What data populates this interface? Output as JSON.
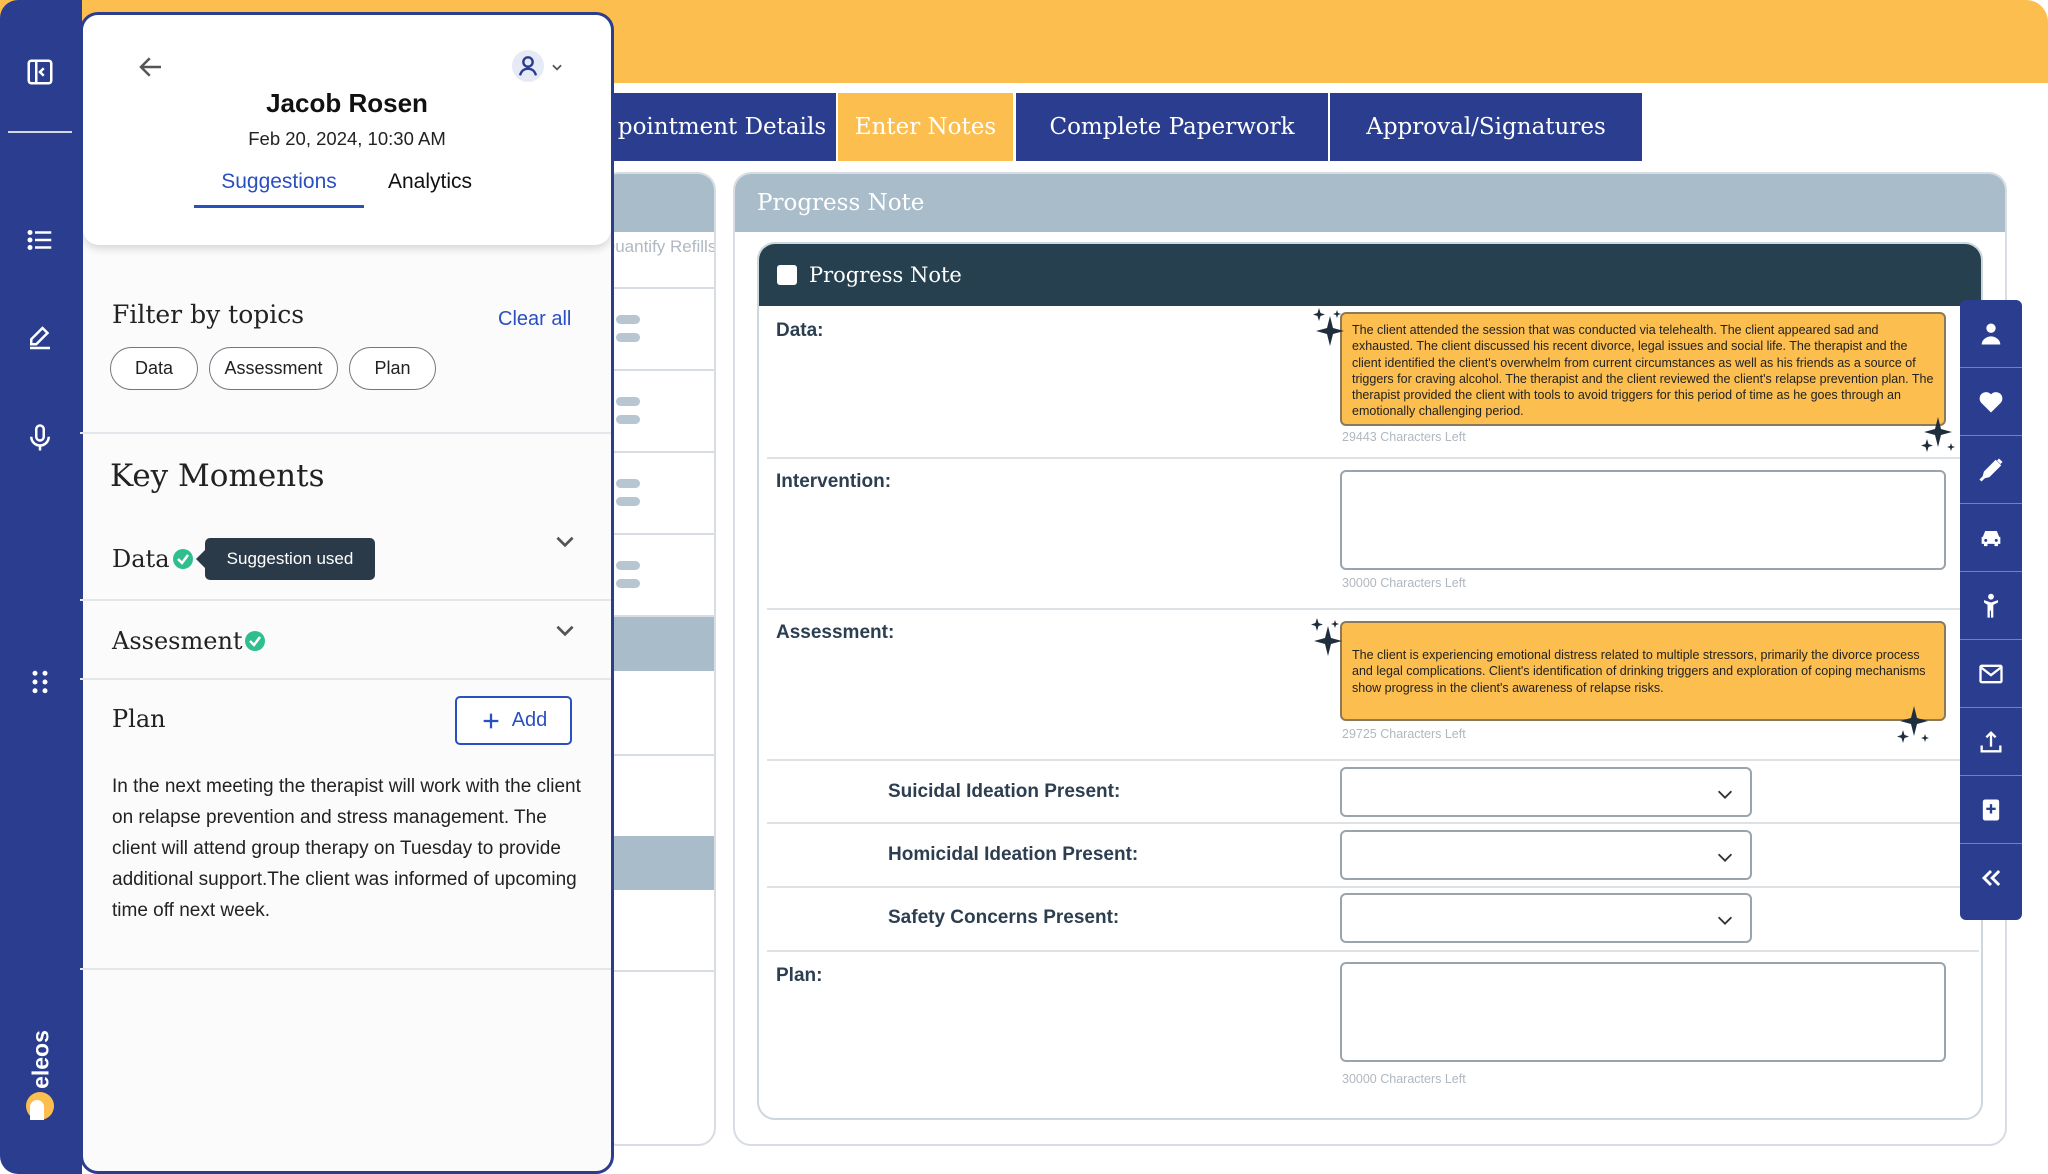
{
  "app": {
    "brand": "eleos"
  },
  "colors": {
    "brand_blue": "#2a3d8f",
    "accent_orange": "#fbbe4f",
    "note_header": "#26404f",
    "success_green": "#2fbf8f"
  },
  "tabs": [
    {
      "label": "Appointment Details",
      "visible_label": "pointment Details",
      "active": false
    },
    {
      "label": "Enter Notes",
      "active": true
    },
    {
      "label": "Complete Paperwork",
      "active": false
    },
    {
      "label": "Approval/Signatures",
      "active": false
    }
  ],
  "leftnav": {
    "icons": [
      "collapse-sidebar-icon",
      "list-icon",
      "pencil-icon",
      "microphone-icon",
      "apps-grid-icon"
    ]
  },
  "panel": {
    "client_name": "Jacob Rosen",
    "session_datetime": "Feb 20, 2024, 10:30 AM",
    "tabs": [
      {
        "label": "Suggestions",
        "active": true
      },
      {
        "label": "Analytics",
        "active": false
      }
    ],
    "filter": {
      "title": "Filter by topics",
      "clear_label": "Clear all",
      "topics": [
        "Data",
        "Assessment",
        "Plan"
      ]
    },
    "key_moments": {
      "title": "Key Moments",
      "items": [
        {
          "label": "Data",
          "used": true,
          "tooltip": "Suggestion used"
        },
        {
          "label": "Assesment",
          "used": true
        }
      ]
    },
    "plan": {
      "label": "Plan",
      "add_label": "Add",
      "text": "In the next meeting the therapist will work with the client on relapse prevention and stress management. The client will attend group therapy on Tuesday to provide additional support.The client was informed of upcoming time off next week."
    }
  },
  "midcol": {
    "header_text": "Quantify Refills"
  },
  "progress_note": {
    "outer_title": "Progress Note",
    "inner_title": "Progress Note",
    "fields": {
      "data": {
        "label": "Data:",
        "value": "The client attended the session that was conducted via telehealth. The client appeared sad and exhausted. The client discussed his recent divorce, legal issues and social life. The therapist and the client identified the client's overwhelm from current circumstances as well as his friends as a source of triggers for craving alcohol. The therapist and the client reviewed the client's relapse prevention plan. The therapist provided the client with tools to avoid triggers for this period of time as he goes through an emotionally challenging period.",
        "chars_left": "29443 Characters Left"
      },
      "intervention": {
        "label": "Intervention:",
        "value": "",
        "chars_left": "30000 Characters Left"
      },
      "assessment": {
        "label": "Assessment:",
        "value": "The client is experiencing emotional distress related to multiple stressors, primarily the divorce process and legal complications. Client's identification of drinking triggers and exploration of coping mechanisms show progress in the client's awareness of relapse risks.",
        "chars_left": "29725 Characters Left"
      },
      "suicidal": {
        "label": "Suicidal Ideation Present:",
        "value": ""
      },
      "homicidal": {
        "label": "Homicidal Ideation Present:",
        "value": ""
      },
      "safety": {
        "label": "Safety Concerns Present:",
        "value": ""
      },
      "plan": {
        "label": "Plan:",
        "value": "",
        "chars_left": "30000 Characters Left"
      }
    }
  },
  "rightrail": {
    "icons": [
      "person-icon",
      "heart-icon",
      "syringe-icon",
      "car-icon",
      "person-standing-icon",
      "mail-icon",
      "upload-icon",
      "medical-book-icon",
      "double-chevron-left-icon"
    ]
  }
}
